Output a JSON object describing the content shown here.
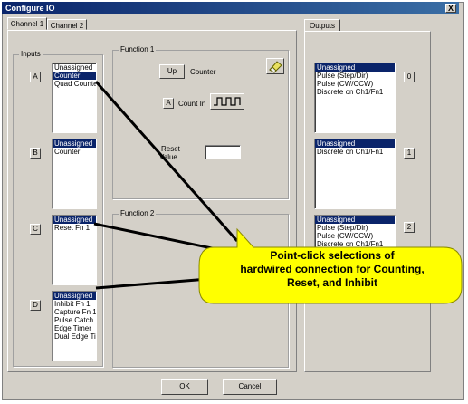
{
  "window": {
    "title": "Configure IO",
    "close_label": "X"
  },
  "tabs": [
    "Channel 1",
    "Channel 2"
  ],
  "outputs_tab": "Outputs",
  "inputs": {
    "label": "Inputs",
    "rows": [
      {
        "letter": "A",
        "items": [
          "Unassigned",
          "Counter",
          "Quad Counter"
        ],
        "selected": 1
      },
      {
        "letter": "B",
        "items": [
          "Unassigned",
          "Counter"
        ],
        "selected": 0
      },
      {
        "letter": "C",
        "items": [
          "Unassigned",
          "Reset Fn 1"
        ],
        "selected": 0
      },
      {
        "letter": "D",
        "items": [
          "Unassigned",
          "Inhibit Fn 1",
          "Capture Fn 1",
          "Pulse Catch",
          "Edge Timer",
          "Dual Edge Timer"
        ],
        "selected": 0
      }
    ]
  },
  "function1": {
    "label": "Function 1",
    "up_button": "Up",
    "counter_label": "Counter",
    "count_in_letter": "A",
    "count_in_label": "Count In",
    "reset_label_line1": "Reset",
    "reset_label_line2": "Value",
    "reset_value": ""
  },
  "function2": {
    "label": "Function 2"
  },
  "outputs": {
    "rows": [
      {
        "number": "0",
        "items": [
          "Unassigned",
          "Pulse (Step/Dir)",
          "Pulse (CW/CCW)",
          "Discrete on Ch1/Fn1"
        ],
        "selected": 0
      },
      {
        "number": "1",
        "items": [
          "Unassigned",
          "Discrete on Ch1/Fn1"
        ],
        "selected": 0
      },
      {
        "number": "2",
        "items": [
          "Unassigned",
          "Pulse (Step/Dir)",
          "Pulse (CW/CCW)",
          "Discrete on Ch1/Fn1"
        ],
        "selected": 0
      }
    ]
  },
  "buttons": {
    "ok": "OK",
    "cancel": "Cancel"
  },
  "callout": {
    "line1": "Point-click selections of",
    "line2": "hardwired connection for Counting,",
    "line3": "Reset, and Inhibit",
    "color": "#ffff00"
  }
}
